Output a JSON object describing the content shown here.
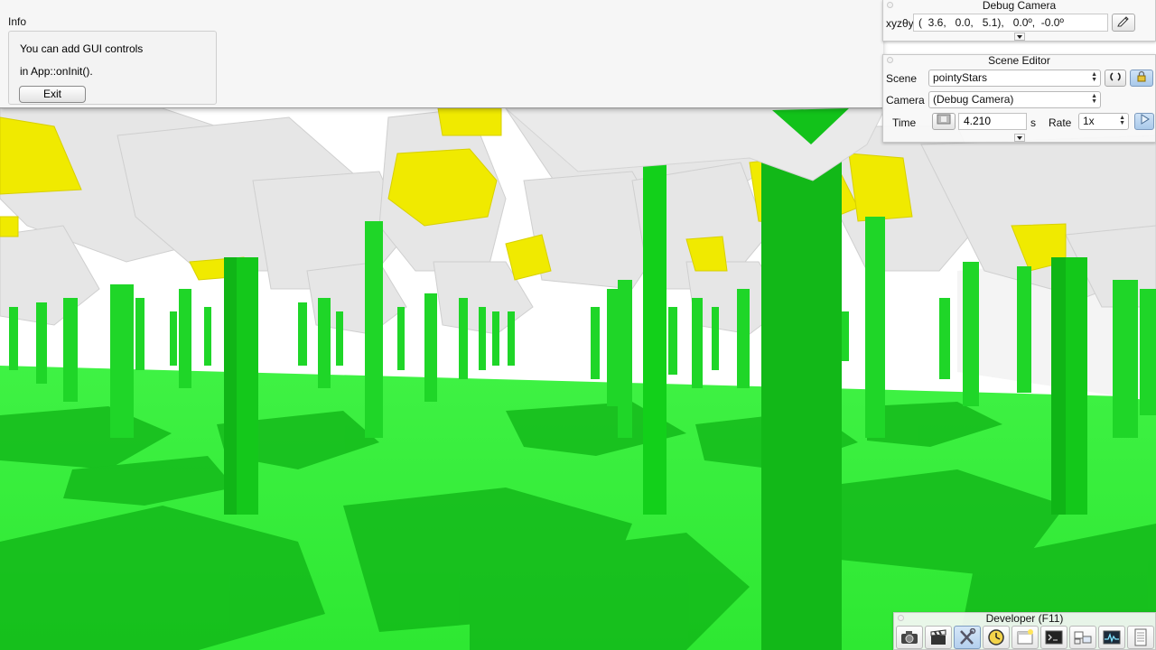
{
  "info_pane": {
    "title": "Info",
    "line1": "You can add GUI controls",
    "line2": "in App::onInit().",
    "exit_label": "Exit"
  },
  "debug_camera": {
    "title": "Debug Camera",
    "xyz_label": "xyzθyθxθz",
    "value": "(  3.6,   0.0,   5.1),   0.0º,  -0.0º"
  },
  "scene_editor": {
    "title": "Scene Editor",
    "scene_label": "Scene",
    "scene_value": "pointyStars",
    "camera_label": "Camera",
    "camera_value": "(Debug Camera)",
    "time_label": "Time",
    "time_value": "4.210",
    "time_unit": "s",
    "rate_label": "Rate",
    "rate_value": "1x"
  },
  "developer": {
    "title": "Developer (F11)",
    "icons": [
      "camera-icon",
      "clapperboard-icon",
      "tools-icon",
      "clock-icon",
      "window-icon",
      "console-icon",
      "scene-graph-icon",
      "profiler-icon",
      "document-icon"
    ]
  },
  "colors": {
    "ground": "#38f23c",
    "pillar": "#16d11f",
    "star_white": "#eeeeee",
    "star_yellow": "#f2ea00",
    "active_blue": "#a9c9ea"
  }
}
